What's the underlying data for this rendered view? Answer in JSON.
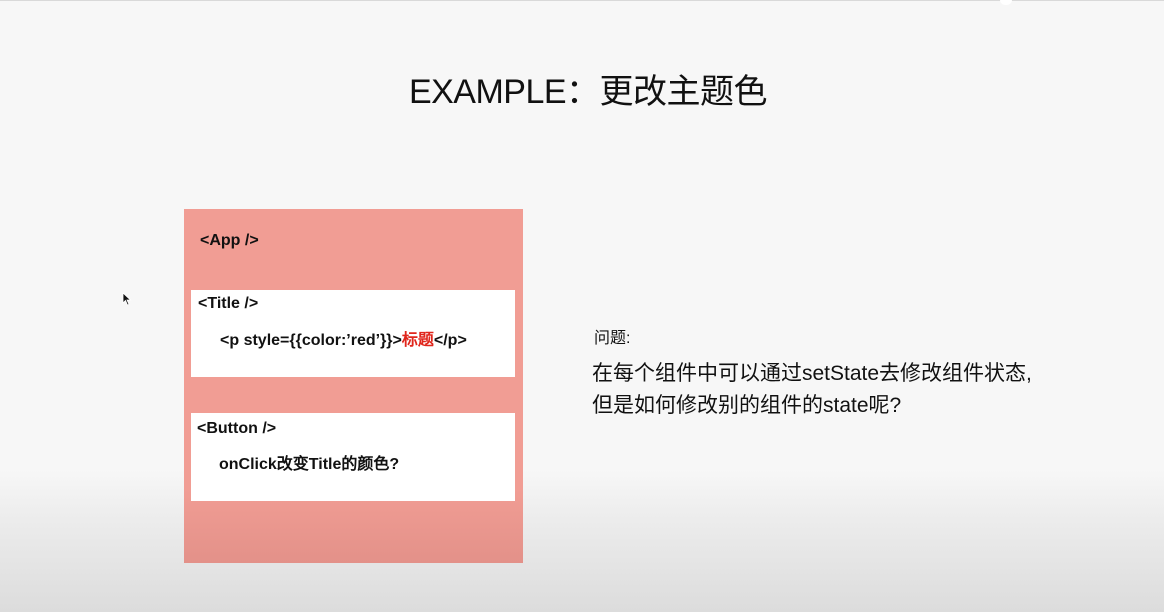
{
  "slide": {
    "title": "EXAMPLE：更改主题色"
  },
  "diagram": {
    "app_label": "<App />",
    "title_component": {
      "label": "<Title />",
      "code_prefix": "<p style={{color:’red’}}>",
      "code_highlight": "标题",
      "code_suffix": "</p>"
    },
    "button_component": {
      "label": "<Button />",
      "code": "onClick改变Title的颜色?"
    }
  },
  "question": {
    "heading": "问题:",
    "line1": "在每个组件中可以通过setState去修改组件状态,",
    "line2": "但是如何修改别的组件的state呢?"
  },
  "colors": {
    "app_box": "#f19d94",
    "highlight_text": "#e0261c"
  },
  "icons": {
    "cursor": "mouse-pointer-icon"
  }
}
